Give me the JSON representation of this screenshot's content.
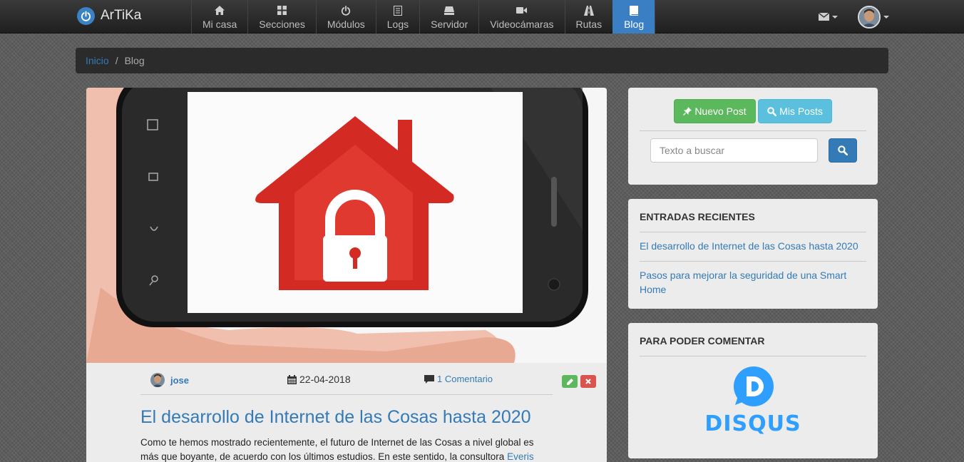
{
  "colors": {
    "accent": "#337ab7",
    "nav_active": "#3a7fc4",
    "success": "#5cb85c",
    "info": "#5bc0de",
    "danger": "#d9534f",
    "disqus": "#2e9fff"
  },
  "brand": {
    "name": "ArTiKa",
    "icon": "power-icon"
  },
  "nav": {
    "items": [
      {
        "label": "Mi casa",
        "icon": "home-icon"
      },
      {
        "label": "Secciones",
        "icon": "grid-icon"
      },
      {
        "label": "Módulos",
        "icon": "power-icon"
      },
      {
        "label": "Logs",
        "icon": "list-icon"
      },
      {
        "label": "Servidor",
        "icon": "server-icon"
      },
      {
        "label": "Videocámaras",
        "icon": "video-camera-icon"
      },
      {
        "label": "Rutas",
        "icon": "road-icon"
      },
      {
        "label": "Blog",
        "icon": "book-icon",
        "active": true
      }
    ]
  },
  "header_right": {
    "messages_icon": "envelope-icon",
    "user_icon": "user-avatar"
  },
  "breadcrumb": {
    "home": "Inicio",
    "current": "Blog"
  },
  "post": {
    "image": "smart-home-lock-phone-image",
    "author": "jose",
    "date": "22-04-2018",
    "comments": "1 Comentario",
    "title": "El desarrollo de Internet de las Cosas hasta 2020",
    "excerpt_before": "Como te hemos mostrado recientemente, el futuro de Internet de las Cosas a nivel global es más que boyante, de acuerdo con los últimos estudios. En este sentido, la consultora ",
    "excerpt_link": "Everis"
  },
  "sidebar": {
    "new_post_label": "Nuevo Post",
    "my_posts_label": "Mis Posts",
    "search_placeholder": "Texto a buscar",
    "recent_heading": "ENTRADAS RECIENTES",
    "recent_items": [
      "El desarrollo de Internet de las Cosas hasta 2020",
      "Pasos para mejorar la seguridad de una Smart Home"
    ],
    "comment_heading": "PARA PODER COMENTAR",
    "disqus_label": "DISQUS"
  }
}
